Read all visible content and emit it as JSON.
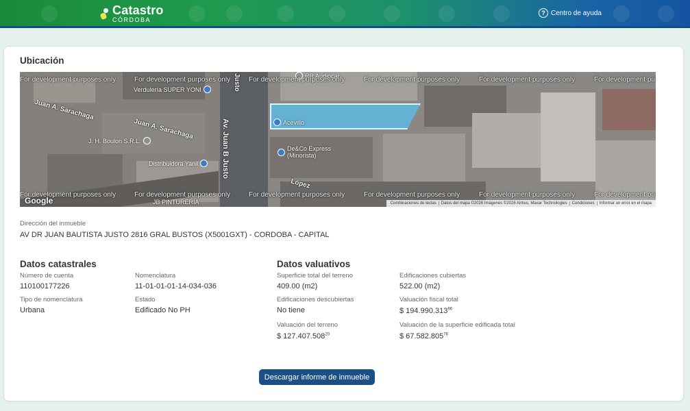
{
  "header": {
    "app_title": "Catastro",
    "app_subtitle": "CÓRDOBA",
    "help_label": "Centro de ayuda",
    "help_icon": "question-circle-icon"
  },
  "location": {
    "title": "Ubicación",
    "map": {
      "dev_watermark": "For development purposes only",
      "google_logo": "Google",
      "streets": [
        "Av. Juan B Justo",
        "Justo",
        "Juan A. Sarachaga",
        "Juan A. Sarachaga",
        "López"
      ],
      "pois": [
        "Verdulería SUPER YONI",
        "J. H. Boulon S.R.L.",
        "Distribuidora Yanil",
        "JB PINTURERIA",
        "Acevillo",
        "De&Co Express (Minorista)",
        "RR Audiocar"
      ],
      "attribution": [
        "Combinaciones de teclas",
        "Datos del mapa ©2026 Imágenes ©2026 Airbus, Maxar Technologies",
        "Condiciones",
        "Informar un error en el mapa"
      ]
    }
  },
  "address": {
    "label": "Dirección del inmueble",
    "value": "AV DR JUAN BAUTISTA JUSTO 2816 GRAL BUSTOS (X5001GXT) - CORDOBA - CAPITAL"
  },
  "catastral": {
    "title": "Datos catastrales",
    "account_label": "Número de cuenta",
    "account_value": "110100177226",
    "nomenclatura_label": "Nomenclatura",
    "nomenclatura_value": "11-01-01-01-14-034-036",
    "tipo_label": "Tipo de nomenclatura",
    "tipo_value": "Urbana",
    "estado_label": "Estado",
    "estado_value": "Edificado No PH"
  },
  "valuativos": {
    "title": "Datos valuativos",
    "sup_terreno_label": "Superficie total del terreno",
    "sup_terreno_value": "409.00 (m2)",
    "edif_cub_label": "Edificaciones cubiertas",
    "edif_cub_value": "522.00 (m2)",
    "edif_desc_label": "Edificaciones descubiertas",
    "edif_desc_value": "No tiene",
    "val_fiscal_label": "Valuación fiscal total",
    "val_fiscal_value": "$ 194.990.313",
    "val_fiscal_cents": "96",
    "val_terreno_label": "Valuación del terreno",
    "val_terreno_value": "$ 127.407.508",
    "val_terreno_cents": "20",
    "val_edif_label": "Valuación de la superficie edificada total",
    "val_edif_value": "$ 67.582.805",
    "val_edif_cents": "76"
  },
  "actions": {
    "download_label": "Descargar informe de inmueble"
  }
}
